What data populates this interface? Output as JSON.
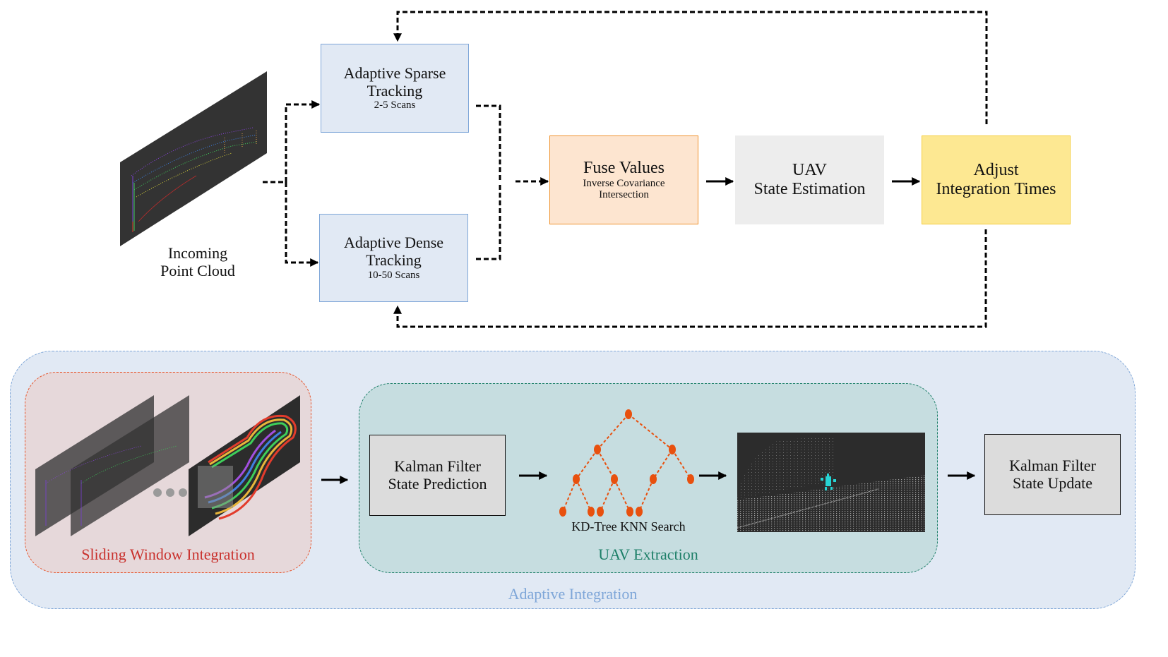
{
  "top_pipeline": {
    "input": {
      "label_line1": "Incoming",
      "label_line2": "Point Cloud",
      "icon": "point-cloud-scan-icon"
    },
    "sparse": {
      "title_line1": "Adaptive Sparse",
      "title_line2": "Tracking",
      "subtitle": "2-5 Scans"
    },
    "dense": {
      "title_line1": "Adaptive Dense",
      "title_line2": "Tracking",
      "subtitle": "10-50 Scans"
    },
    "fuse": {
      "title": "Fuse Values",
      "subtitle_line1": "Inverse Covariance",
      "subtitle_line2": "Intersection"
    },
    "uav": {
      "title_line1": "UAV",
      "title_line2": "State Estimation"
    },
    "adjust": {
      "title_line1": "Adjust",
      "title_line2": "Integration Times"
    }
  },
  "bottom_pipeline": {
    "group_label": "Adaptive Integration",
    "sliding_window": {
      "label": "Sliding Window Integration",
      "icon": "stacked-scans-icon"
    },
    "uav_extraction": {
      "label": "UAV Extraction",
      "kf_prediction": {
        "line1": "Kalman Filter",
        "line2": "State Prediction"
      },
      "kdtree": {
        "label": "KD-Tree KNN Search",
        "icon": "kd-tree-icon"
      },
      "scene": {
        "icon": "uav-point-cloud-scene-icon"
      }
    },
    "kf_update": {
      "line1": "Kalman Filter",
      "line2": "State Update"
    }
  },
  "colors": {
    "tracking_fill": "#e1e9f4",
    "tracking_border": "#7ea6d8",
    "fuse_fill": "#fde5d0",
    "fuse_border": "#f0922e",
    "uav_fill": "#ededed",
    "adjust_fill": "#fde892",
    "adjust_border": "#f5cd3d",
    "sliding_fill": "#e6d8da",
    "sliding_border": "#e6532a",
    "sliding_text": "#c9302c",
    "extraction_fill": "#c6dde0",
    "extraction_border": "#1d7f68",
    "tree_color": "#e8500e",
    "uav_points": "#27d3d3"
  }
}
